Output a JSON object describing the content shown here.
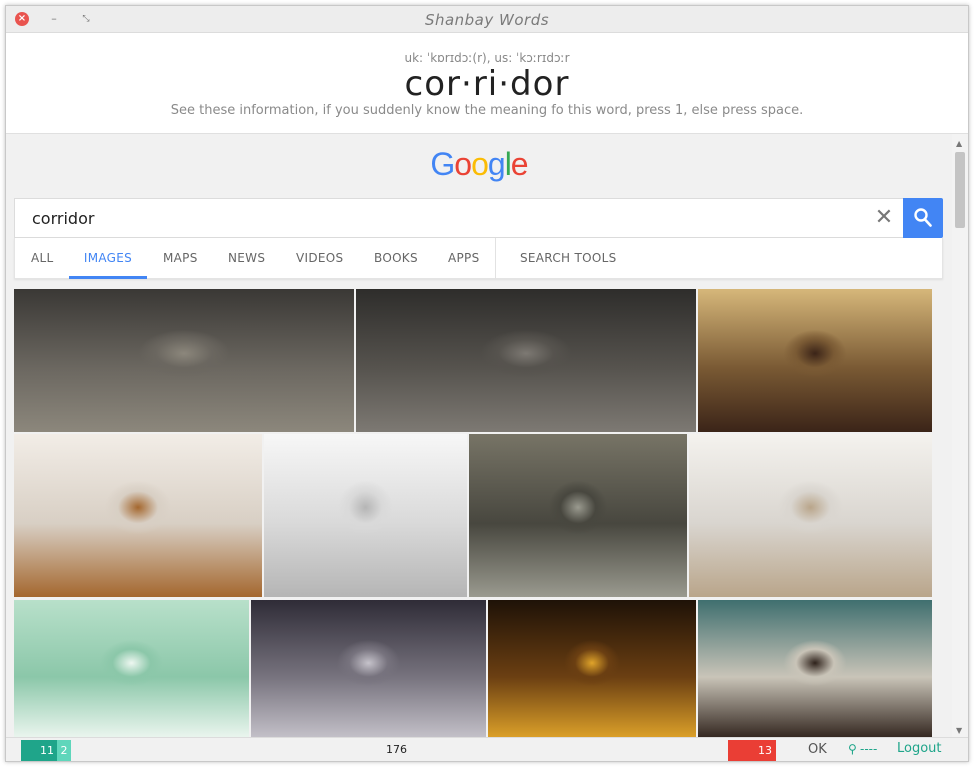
{
  "window": {
    "title": "Shanbay Words",
    "close_glyph": "×",
    "minimize_glyph": "–",
    "maximize_glyph": "⤡"
  },
  "word": {
    "phonetic": "uk: ˈkɒrɪdɔː(r), us: ˈkɔːrɪdɔːr",
    "text": "cor·ri·dor",
    "hint": "See these information, if you suddenly know the meaning fo this word, press 1, else press space."
  },
  "google": {
    "logo_letters": [
      "G",
      "o",
      "o",
      "g",
      "l",
      "e"
    ],
    "search_value": "corridor",
    "clear_glyph": "✕",
    "tabs": [
      "ALL",
      "IMAGES",
      "MAPS",
      "NEWS",
      "VIDEOS",
      "BOOKS",
      "APPS",
      "SEARCH TOOLS"
    ],
    "active_tab": "IMAGES",
    "image_results": [
      {
        "name": "corridor-image-1",
        "colors": [
          "#3a3835",
          "#6b6760",
          "#8c877c"
        ]
      },
      {
        "name": "corridor-image-2",
        "colors": [
          "#2e2d2b",
          "#56534e",
          "#7d7973"
        ]
      },
      {
        "name": "corridor-image-3",
        "colors": [
          "#d6b77a",
          "#7a5a34",
          "#3b2418"
        ]
      },
      {
        "name": "corridor-image-4",
        "colors": [
          "#f2ede7",
          "#d8cfc4",
          "#a4672e"
        ]
      },
      {
        "name": "corridor-image-5",
        "colors": [
          "#f7f7f7",
          "#d9d9d9",
          "#b5b5b5"
        ]
      },
      {
        "name": "corridor-image-6",
        "colors": [
          "#777466",
          "#48473f",
          "#9a9a8f"
        ]
      },
      {
        "name": "corridor-image-7",
        "colors": [
          "#f4f2ee",
          "#d9d5cf",
          "#b9a58a"
        ]
      },
      {
        "name": "corridor-image-8",
        "colors": [
          "#b8e0ca",
          "#8bc7a9",
          "#eef7f1"
        ]
      },
      {
        "name": "corridor-image-9",
        "colors": [
          "#2f2c37",
          "#77737e",
          "#c6c3cb"
        ]
      },
      {
        "name": "corridor-image-10",
        "colors": [
          "#1e1207",
          "#6b3f12",
          "#e0a42a"
        ]
      },
      {
        "name": "corridor-image-11",
        "colors": [
          "#3f6f6f",
          "#c9c4b8",
          "#2e211a"
        ]
      }
    ]
  },
  "status": {
    "known_count": "11",
    "learning_count": "2",
    "remaining_count": "176",
    "wrong_count": "13",
    "ok_label": "OK",
    "user_name": "----",
    "logout_label": "Logout"
  },
  "colors": {
    "accent_green": "#1fa58a",
    "light_green": "#5fd6bb",
    "error_red": "#ea3e35",
    "google_blue": "#4285f4"
  }
}
